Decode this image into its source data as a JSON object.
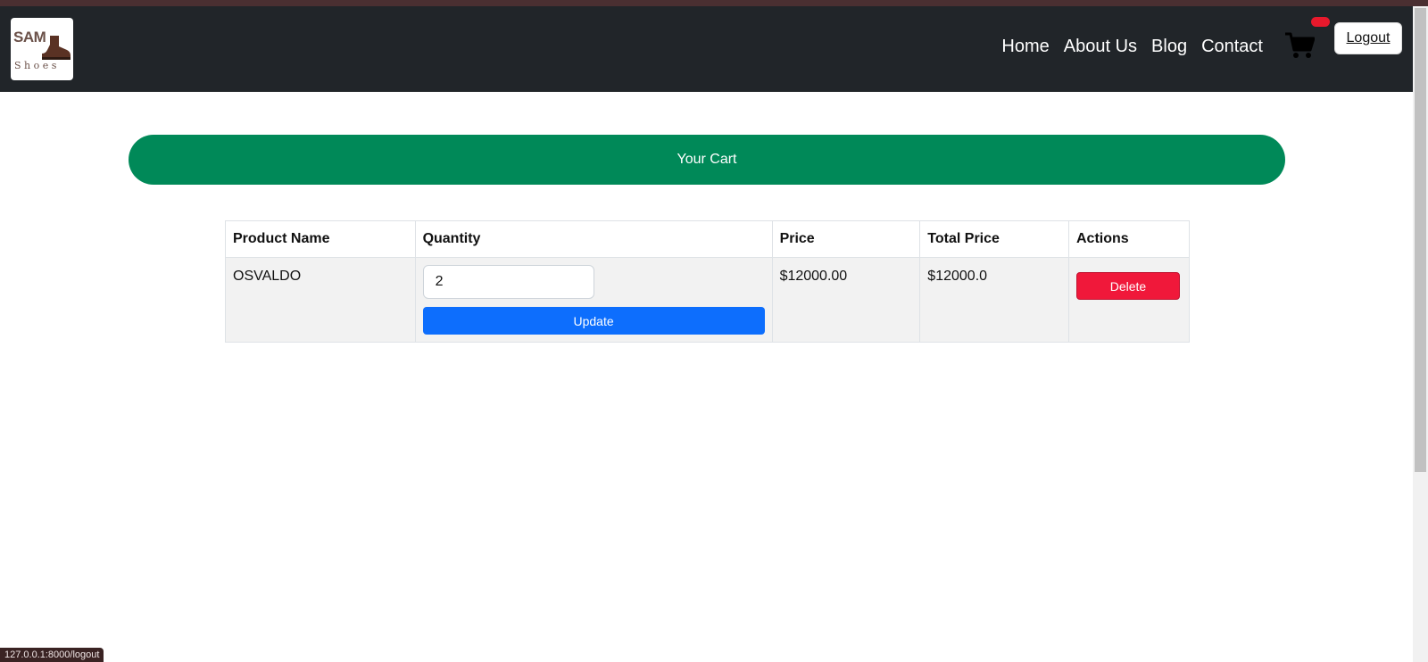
{
  "brand": {
    "logo_top": "SAM",
    "logo_bottom": "Shoes"
  },
  "nav": {
    "items": [
      {
        "label": "Home"
      },
      {
        "label": "About Us"
      },
      {
        "label": "Blog"
      },
      {
        "label": "Contact"
      }
    ],
    "cart_icon": "shopping-cart-icon",
    "logout_label": "Logout"
  },
  "cart": {
    "title": "Your Cart",
    "columns": [
      "Product Name",
      "Quantity",
      "Price",
      "Total Price",
      "Actions"
    ],
    "rows": [
      {
        "product_name": "OSVALDO",
        "quantity": "2",
        "price": "$12000.00",
        "total_price": "$12000.0",
        "update_label": "Update",
        "delete_label": "Delete"
      }
    ]
  },
  "status_bar": {
    "url": "127.0.0.1:8000/logout"
  },
  "colors": {
    "navbar": "#212529",
    "banner": "#008958",
    "update": "#0d6efd",
    "delete": "#f0183a",
    "badge": "#e8192c"
  }
}
